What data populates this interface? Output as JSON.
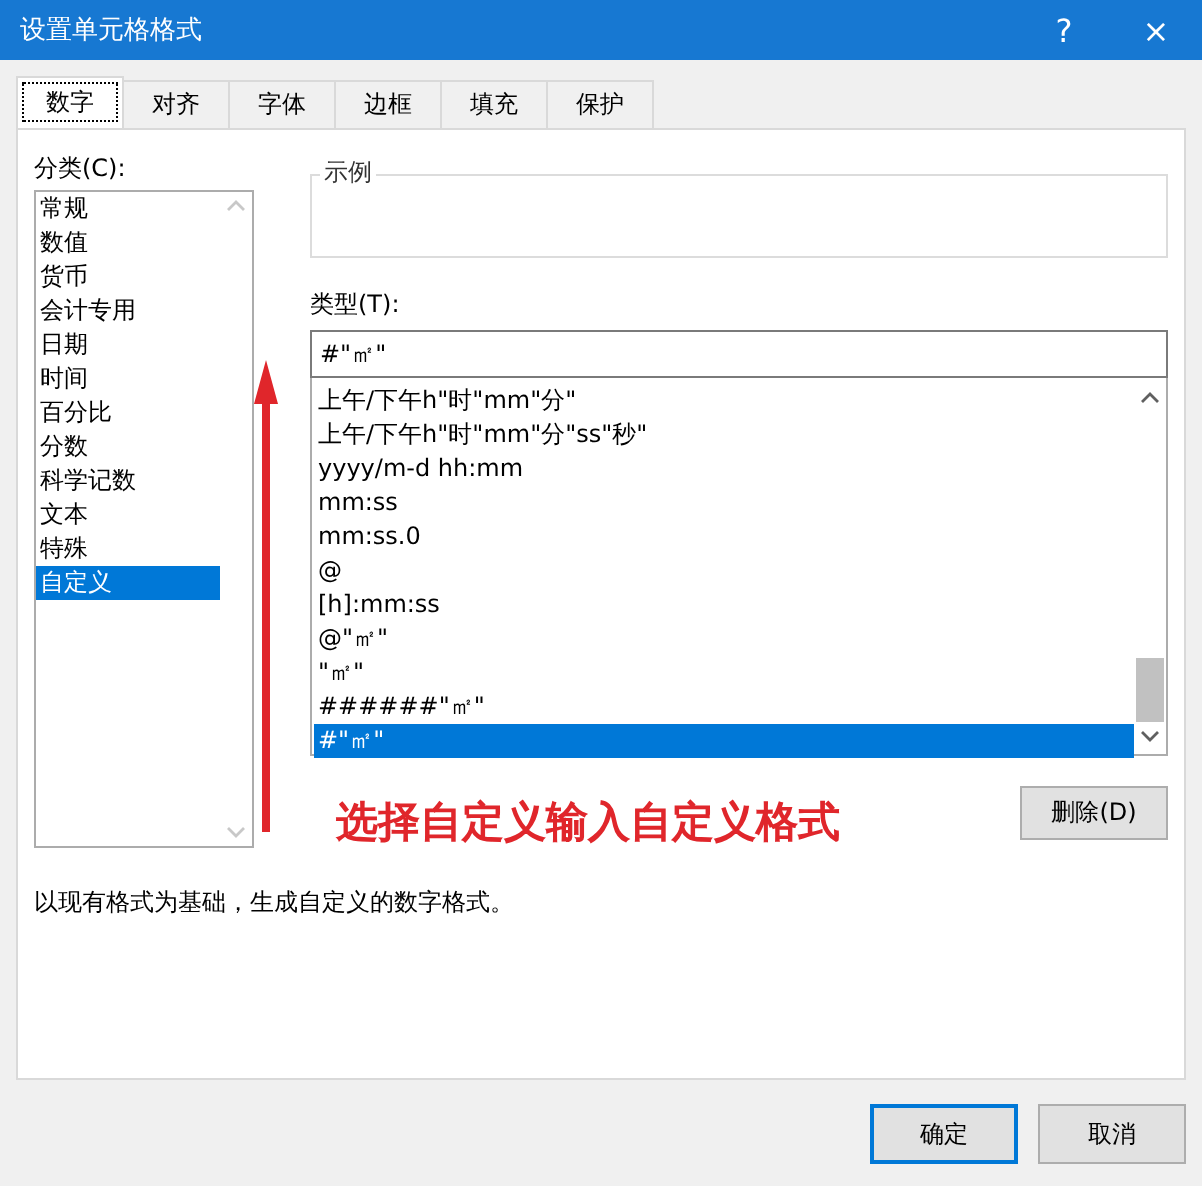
{
  "window": {
    "title": "设置单元格格式",
    "help": "?",
    "close": "×"
  },
  "tabs": [
    {
      "label": "数字",
      "selected": true
    },
    {
      "label": "对齐",
      "selected": false
    },
    {
      "label": "字体",
      "selected": false
    },
    {
      "label": "边框",
      "selected": false
    },
    {
      "label": "填充",
      "selected": false
    },
    {
      "label": "保护",
      "selected": false
    }
  ],
  "category": {
    "label": "分类(C):",
    "items": [
      {
        "label": "常规",
        "selected": false
      },
      {
        "label": "数值",
        "selected": false
      },
      {
        "label": "货币",
        "selected": false
      },
      {
        "label": "会计专用",
        "selected": false
      },
      {
        "label": "日期",
        "selected": false
      },
      {
        "label": "时间",
        "selected": false
      },
      {
        "label": "百分比",
        "selected": false
      },
      {
        "label": "分数",
        "selected": false
      },
      {
        "label": "科学记数",
        "selected": false
      },
      {
        "label": "文本",
        "selected": false
      },
      {
        "label": "特殊",
        "selected": false
      },
      {
        "label": "自定义",
        "selected": true
      }
    ]
  },
  "sample": {
    "label": "示例"
  },
  "type": {
    "label": "类型(T):",
    "value": "#\"㎡\"",
    "items": [
      {
        "label": "上午/下午h\"时\"mm\"分\"",
        "selected": false
      },
      {
        "label": "上午/下午h\"时\"mm\"分\"ss\"秒\"",
        "selected": false
      },
      {
        "label": "yyyy/m-d hh:mm",
        "selected": false
      },
      {
        "label": "mm:ss",
        "selected": false
      },
      {
        "label": "mm:ss.0",
        "selected": false
      },
      {
        "label": "@",
        "selected": false
      },
      {
        "label": "[h]:mm:ss",
        "selected": false
      },
      {
        "label": "@\"㎡\"",
        "selected": false
      },
      {
        "label": "\"㎡\"",
        "selected": false
      },
      {
        "label": "######\"㎡\"",
        "selected": false
      },
      {
        "label": "#\"㎡\"",
        "selected": true
      }
    ]
  },
  "delete_button": "删除(D)",
  "annotation": "选择自定义输入自定义格式",
  "description": "以现有格式为基础，生成自定义的数字格式。",
  "buttons": [
    {
      "label": "确定",
      "default": true
    },
    {
      "label": "取消",
      "default": false
    }
  ]
}
